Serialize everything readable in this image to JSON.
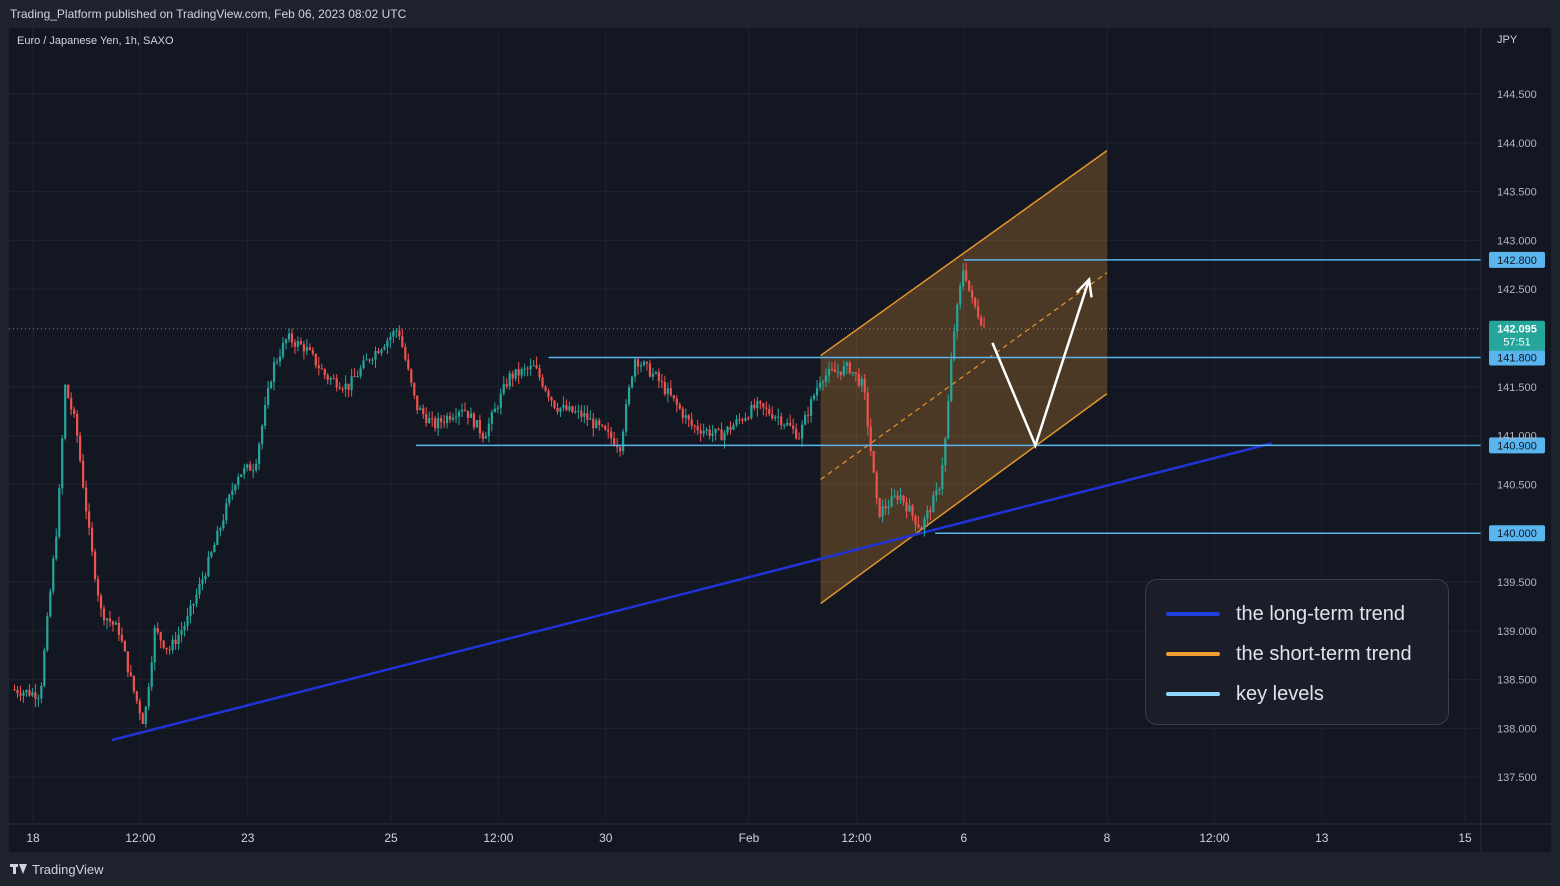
{
  "header": {
    "published": "Trading_Platform published on TradingView.com, Feb 06, 2023 08:02 UTC"
  },
  "chart_data": {
    "type": "candlestick",
    "symbol": "Euro / Japanese Yen, 1h, SAXO",
    "currency": "JPY",
    "ylim": [
      137.1,
      145.0
    ],
    "y_ticks": [
      "144.500",
      "144.000",
      "143.500",
      "143.000",
      "142.500",
      "141.500",
      "141.000",
      "140.500",
      "139.500",
      "139.000",
      "138.500",
      "138.000",
      "137.500"
    ],
    "x_ticks": [
      {
        "label": "18",
        "t": 0
      },
      {
        "label": "12:00",
        "t": 1.5
      },
      {
        "label": "23",
        "t": 3
      },
      {
        "label": "25",
        "t": 5
      },
      {
        "label": "12:00",
        "t": 6.5
      },
      {
        "label": "30",
        "t": 8
      },
      {
        "label": "Feb",
        "t": 10
      },
      {
        "label": "12:00",
        "t": 11.5
      },
      {
        "label": "6",
        "t": 13
      },
      {
        "label": "8",
        "t": 15
      },
      {
        "label": "12:00",
        "t": 16.5
      },
      {
        "label": "13",
        "t": 18
      },
      {
        "label": "15",
        "t": 20
      }
    ],
    "price_anchors": [
      {
        "t": -0.3,
        "p": 138.4
      },
      {
        "t": 0.1,
        "p": 138.35
      },
      {
        "t": 0.35,
        "p": 140.2
      },
      {
        "t": 0.45,
        "p": 141.5
      },
      {
        "t": 0.6,
        "p": 141.1
      },
      {
        "t": 0.8,
        "p": 139.9
      },
      {
        "t": 0.95,
        "p": 139.2
      },
      {
        "t": 1.2,
        "p": 139.0
      },
      {
        "t": 1.4,
        "p": 138.4
      },
      {
        "t": 1.55,
        "p": 138.05
      },
      {
        "t": 1.7,
        "p": 139.0
      },
      {
        "t": 1.9,
        "p": 138.8
      },
      {
        "t": 2.15,
        "p": 139.1
      },
      {
        "t": 2.5,
        "p": 139.8
      },
      {
        "t": 2.85,
        "p": 140.6
      },
      {
        "t": 3.1,
        "p": 140.7
      },
      {
        "t": 3.35,
        "p": 141.7
      },
      {
        "t": 3.55,
        "p": 142.0
      },
      {
        "t": 3.8,
        "p": 141.9
      },
      {
        "t": 4.1,
        "p": 141.6
      },
      {
        "t": 4.4,
        "p": 141.5
      },
      {
        "t": 4.7,
        "p": 141.8
      },
      {
        "t": 5.1,
        "p": 142.1
      },
      {
        "t": 5.35,
        "p": 141.3
      },
      {
        "t": 5.6,
        "p": 141.1
      },
      {
        "t": 6.0,
        "p": 141.3
      },
      {
        "t": 6.3,
        "p": 141.0
      },
      {
        "t": 6.65,
        "p": 141.6
      },
      {
        "t": 7.0,
        "p": 141.7
      },
      {
        "t": 7.3,
        "p": 141.3
      },
      {
        "t": 7.7,
        "p": 141.2
      },
      {
        "t": 8.2,
        "p": 140.9
      },
      {
        "t": 8.4,
        "p": 141.8
      },
      {
        "t": 8.7,
        "p": 141.6
      },
      {
        "t": 9.2,
        "p": 141.1
      },
      {
        "t": 9.6,
        "p": 141.0
      },
      {
        "t": 10.1,
        "p": 141.3
      },
      {
        "t": 10.4,
        "p": 141.2
      },
      {
        "t": 10.7,
        "p": 141.0
      },
      {
        "t": 11.0,
        "p": 141.6
      },
      {
        "t": 11.4,
        "p": 141.7
      },
      {
        "t": 11.6,
        "p": 141.5
      },
      {
        "t": 11.8,
        "p": 140.2
      },
      {
        "t": 12.1,
        "p": 140.4
      },
      {
        "t": 12.4,
        "p": 140.05
      },
      {
        "t": 12.65,
        "p": 140.45
      },
      {
        "t": 12.75,
        "p": 141.0
      },
      {
        "t": 12.85,
        "p": 142.0
      },
      {
        "t": 12.95,
        "p": 142.5
      },
      {
        "t": 13.0,
        "p": 142.75
      },
      {
        "t": 13.1,
        "p": 142.4
      },
      {
        "t": 13.3,
        "p": 142.1
      }
    ],
    "key_levels": [
      "142.800",
      "141.800",
      "140.900",
      "140.000"
    ],
    "current_price": {
      "value": "142.095",
      "countdown": "57:51"
    },
    "long_term_trend": {
      "from": {
        "t": 1.1,
        "p": 137.88
      },
      "to": {
        "t": 17.3,
        "p": 140.92
      }
    },
    "short_term_channel": {
      "start_t": 11.0,
      "end_t": 15.0,
      "upper": [
        141.82,
        143.92
      ],
      "lower": [
        139.28,
        141.43
      ],
      "mid": [
        140.55,
        142.67
      ]
    },
    "projection_path": [
      {
        "t": 13.4,
        "p": 141.95
      },
      {
        "t": 14.0,
        "p": 140.9
      },
      {
        "t": 14.75,
        "p": 142.6
      }
    ],
    "colors": {
      "bull": "#26a69a",
      "bear": "#ef5350",
      "key_level": "#5ab4ee",
      "long_term": "#2033d6",
      "short_term": "#e3952d",
      "projection": "#ffffff",
      "price_label_bg": "#26a69a"
    }
  },
  "legend": {
    "items": [
      {
        "label": "the long-term trend",
        "color": "#1f3fe0"
      },
      {
        "label": "the short-term trend",
        "color": "#f29d2f"
      },
      {
        "label": "key levels",
        "color": "#8fd7ff"
      }
    ]
  },
  "footer": {
    "brand": "TradingView"
  }
}
